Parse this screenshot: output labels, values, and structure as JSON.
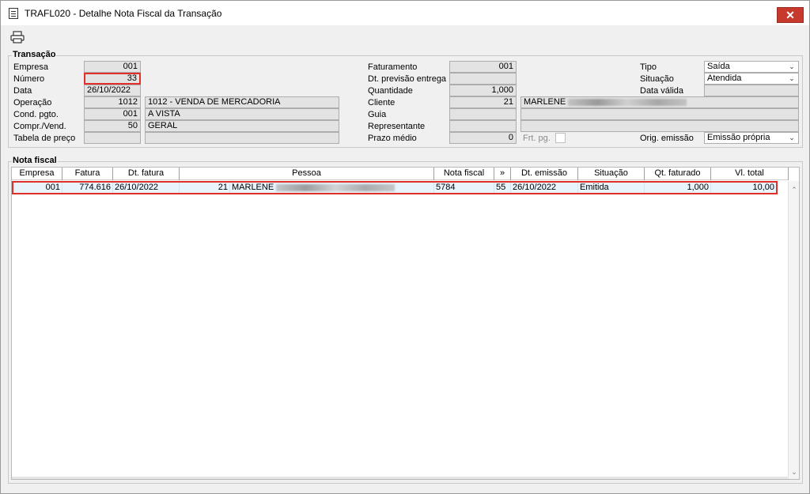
{
  "window": {
    "title": "TRAFL020 - Detalhe Nota Fiscal da Transação",
    "close_label": "✕"
  },
  "toolbar": {
    "print_icon": "printer-icon"
  },
  "transacao": {
    "group_label": "Transação",
    "empresa": {
      "label": "Empresa",
      "value": "001"
    },
    "numero": {
      "label": "Número",
      "value": "33"
    },
    "data": {
      "label": "Data",
      "value": "26/10/2022"
    },
    "operacao": {
      "label": "Operação",
      "code": "1012",
      "desc": "1012 - VENDA DE MERCADORIA"
    },
    "cond_pgto": {
      "label": "Cond. pgto.",
      "code": "001",
      "desc": " A VISTA"
    },
    "compr_vend": {
      "label": "Compr./Vend.",
      "code": "50",
      "desc": "GERAL"
    },
    "tabela_preco": {
      "label": "Tabela de preço",
      "code": "",
      "desc": ""
    },
    "faturamento": {
      "label": "Faturamento",
      "value": "001"
    },
    "dt_prev_entrega": {
      "label": "Dt. previsão entrega",
      "value": ""
    },
    "quantidade": {
      "label": "Quantidade",
      "value": "1,000"
    },
    "cliente": {
      "label": "Cliente",
      "code": "21",
      "name": "MARLENE"
    },
    "guia": {
      "label": "Guia",
      "code": "",
      "desc": ""
    },
    "representante": {
      "label": "Representante",
      "code": "",
      "desc": ""
    },
    "prazo_medio": {
      "label": "Prazo médio",
      "value": "0"
    },
    "frt_pg": {
      "label": "Frt. pg."
    },
    "tipo": {
      "label": "Tipo",
      "value": "Saída"
    },
    "situacao": {
      "label": "Situação",
      "value": "Atendida"
    },
    "data_valida": {
      "label": "Data válida",
      "value": ""
    },
    "orig_emissao": {
      "label": "Orig. emissão",
      "value": "Emissão própria"
    }
  },
  "nota_fiscal": {
    "group_label": "Nota fiscal",
    "columns": [
      "Empresa",
      "Fatura",
      "Dt. fatura",
      "Pessoa",
      "Nota fiscal",
      "»",
      "Dt. emissão",
      "Situação",
      "Qt. faturado",
      "Vl. total"
    ],
    "rows": [
      {
        "empresa": "001",
        "fatura": "774.616",
        "dt_fatura": "26/10/2022",
        "pessoa_code": "21",
        "pessoa_name": "MARLENE",
        "nota_fiscal": "5784",
        "serie": "55",
        "dt_emissao": "26/10/2022",
        "situacao": "Emitida",
        "qt_faturado": "1,000",
        "vl_total": "10,00"
      }
    ]
  },
  "colors": {
    "highlight_border": "#e0302a",
    "close_button": "#c7392c",
    "field_bg": "#e3e3e3"
  }
}
